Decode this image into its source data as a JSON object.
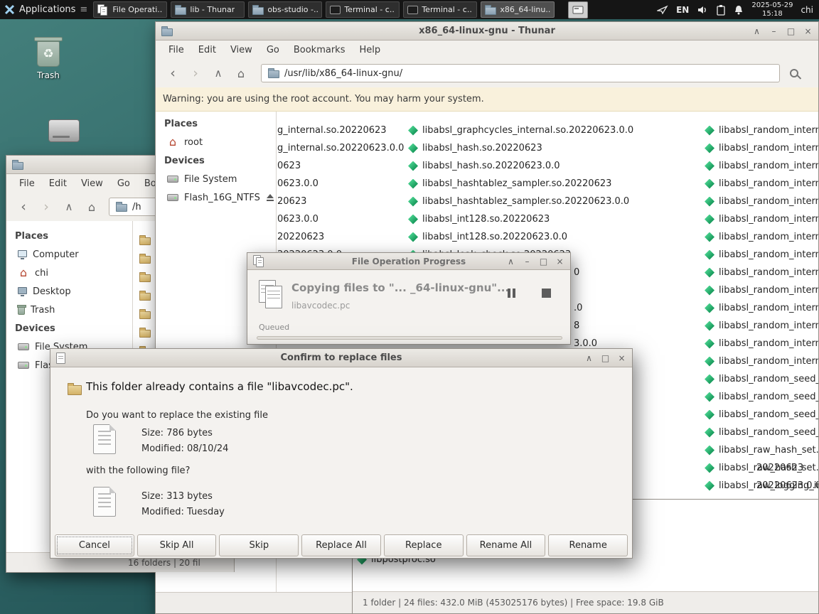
{
  "accent_colors": {
    "desktop_teal": "#2e6465",
    "gem_green": "#12a05c",
    "warning_bg": "#f9f1dc"
  },
  "panel": {
    "applications": "Applications",
    "tasks": [
      "File Operati...",
      "lib - Thunar",
      "obs-studio -...",
      "Terminal - c...",
      "Terminal - c...",
      "x86_64-linu..."
    ],
    "language": "EN",
    "date": "2025-05-29",
    "time": "15:18",
    "user": "chi"
  },
  "desktop": {
    "trash": "Trash"
  },
  "back_window": {
    "menu": [
      "File",
      "Edit",
      "View",
      "Go",
      "Bookmarks"
    ],
    "path": "/h",
    "places_header": "Places",
    "places": [
      "Computer",
      "chi",
      "Desktop",
      "Trash"
    ],
    "devices_header": "Devices",
    "devices": [
      "File System",
      "Flash_16G_NTFS"
    ],
    "status": "16 folders  |  20 fil"
  },
  "main_window": {
    "title": "x86_64-linux-gnu - Thunar",
    "menu": [
      "File",
      "Edit",
      "View",
      "Go",
      "Bookmarks",
      "Help"
    ],
    "path": "/usr/lib/x86_64-linux-gnu/",
    "warning": "Warning: you are using the root account. You may harm your system.",
    "places_header": "Places",
    "places": [
      "root"
    ],
    "devices_header": "Devices",
    "devices": [
      "File System",
      "Flash_16G_NTFS"
    ],
    "file_col1": [
      "g_internal.so.20220623",
      "g_internal.so.20220623.0.0",
      "0623",
      "0623.0.0",
      "20623",
      "0623.0.0",
      "20220623",
      "20220623.0.0"
    ],
    "file_col2": [
      "libabsl_graphcycles_internal.so.20220623.0.0",
      "libabsl_hash.so.20220623",
      "libabsl_hash.so.20220623.0.0",
      "libabsl_hashtablez_sampler.so.20220623",
      "libabsl_hashtablez_sampler.so.20220623.0.0",
      "libabsl_int128.so.20220623",
      "libabsl_int128.so.20220623.0.0",
      "libabsl_leak_check.so.20220623"
    ],
    "file_col2_tails": [
      "0",
      ".0",
      "8",
      "3.0.0",
      "20220623",
      "20220623.0.0"
    ],
    "file_col3": [
      "libabsl_random_interna",
      "libabsl_random_interna",
      "libabsl_random_interna",
      "libabsl_random_interna",
      "libabsl_random_interna",
      "libabsl_random_interna",
      "libabsl_random_interna",
      "libabsl_random_interna",
      "libabsl_random_interna",
      "libabsl_random_interna",
      "libabsl_random_interna",
      "libabsl_random_interna",
      "libabsl_random_interna",
      "libabsl_random_interna",
      "libabsl_random_seed_g",
      "libabsl_random_seed_g",
      "libabsl_random_seed_s",
      "libabsl_random_seed_s",
      "libabsl_raw_hash_set.s",
      "libabsl_raw_hash_set.s",
      "libabsl_raw_logging_int"
    ]
  },
  "lib_window": {
    "file": "libpostproc.so",
    "status": "1 folder  |  24 files: 432.0 MiB (453025176 bytes)  |  Free space: 19.8 GiB"
  },
  "progress_dialog": {
    "title": "File Operation Progress",
    "message": "Copying files to \"... _64-linux-gnu\"...",
    "filename": "libavcodec.pc",
    "state": "Queued"
  },
  "replace_dialog": {
    "title": "Confirm to replace files",
    "heading": "This folder already contains a file \"libavcodec.pc\".",
    "question": "Do you want to replace the existing file",
    "existing_size": "Size: 786 bytes",
    "existing_modified": "Modified: 08/10/24",
    "question2": "with the following file?",
    "new_size": "Size: 313 bytes",
    "new_modified": "Modified: Tuesday",
    "buttons": [
      "Cancel",
      "Skip All",
      "Skip",
      "Replace All",
      "Replace",
      "Rename All",
      "Rename"
    ]
  }
}
